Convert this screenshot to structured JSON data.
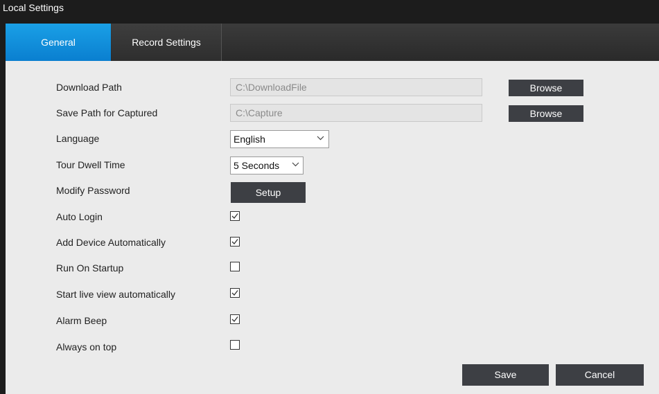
{
  "window": {
    "title": "Local Settings"
  },
  "tabs": [
    {
      "label": "General",
      "active": true
    },
    {
      "label": "Record Settings",
      "active": false
    }
  ],
  "general": {
    "download_path": {
      "label": "Download Path",
      "value": "C:\\DownloadFile",
      "button": "Browse"
    },
    "save_path": {
      "label": "Save Path for Captured",
      "value": "C:\\Capture",
      "button": "Browse"
    },
    "language": {
      "label": "Language",
      "value": "English"
    },
    "tour_dwell_time": {
      "label": "Tour Dwell Time",
      "value": "5 Seconds"
    },
    "modify_password": {
      "label": "Modify Password",
      "button": "Setup"
    },
    "options": [
      {
        "label": "Auto Login",
        "checked": true
      },
      {
        "label": "Add Device Automatically",
        "checked": true
      },
      {
        "label": "Run On Startup",
        "checked": false
      },
      {
        "label": "Start live view automatically",
        "checked": true
      },
      {
        "label": "Alarm Beep",
        "checked": true
      },
      {
        "label": "Always on top",
        "checked": false
      }
    ]
  },
  "footer": {
    "save": "Save",
    "cancel": "Cancel"
  },
  "colors": {
    "accent": "#0a7fd0",
    "button": "#3d3f44",
    "panel": "#ebebeb",
    "chrome": "#1c1c1c"
  },
  "icons": {
    "dropdown": "chevron-down-icon",
    "check": "checkmark-icon"
  }
}
